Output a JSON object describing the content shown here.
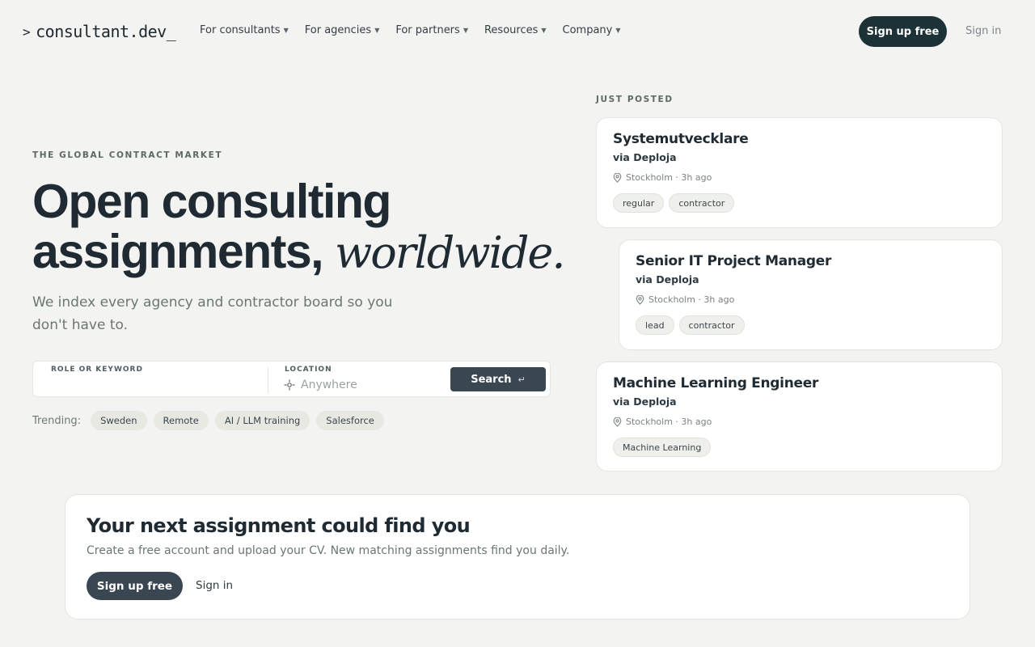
{
  "nav": {
    "logo_prefix": ">",
    "logo": "consultant.dev_",
    "items": [
      {
        "label": "For consultants"
      },
      {
        "label": "For agencies"
      },
      {
        "label": "For partners"
      },
      {
        "label": "Resources"
      },
      {
        "label": "Company"
      }
    ],
    "signup": "Sign up free",
    "signin": "Sign in"
  },
  "hero": {
    "eyebrow": "THE GLOBAL CONTRACT MARKET",
    "title_line1": "Open consulting",
    "title_line2": "assignments,",
    "title_em": "worldwide.",
    "subtitle": "We index every agency and contractor board so you don't have to."
  },
  "search": {
    "role_label": "ROLE OR KEYWORD",
    "role_value": "",
    "location_label": "LOCATION",
    "location_placeholder": "Anywhere",
    "button": "Search",
    "button_hint": "↵"
  },
  "trending": {
    "label": "Trending:",
    "chips": [
      "Sweden",
      "Remote",
      "AI / LLM training",
      "Salesforce"
    ]
  },
  "just_posted": {
    "label": "JUST POSTED",
    "jobs": [
      {
        "title": "Systemutvecklare",
        "via": "via Deploja",
        "meta": "Stockholm · 3h ago",
        "tags": [
          "regular",
          "contractor"
        ]
      },
      {
        "title": "Senior IT Project Manager",
        "via": "via Deploja",
        "meta": "Stockholm · 3h ago",
        "tags": [
          "lead",
          "contractor"
        ]
      },
      {
        "title": "Machine Learning Engineer",
        "via": "via Deploja",
        "meta": "Stockholm · 3h ago",
        "tags": [
          "Machine Learning"
        ]
      }
    ]
  },
  "cta": {
    "title": "Your next assignment could find you",
    "subtitle": "Create a free account and upload your CV. New matching assignments find you daily.",
    "signup": "Sign up free",
    "signin": "Sign in"
  },
  "colors": {
    "background": "#f3f3f1",
    "primary_dark": "#1d3236",
    "button_slate": "#3b4653",
    "text_dark": "#1f2a33"
  }
}
